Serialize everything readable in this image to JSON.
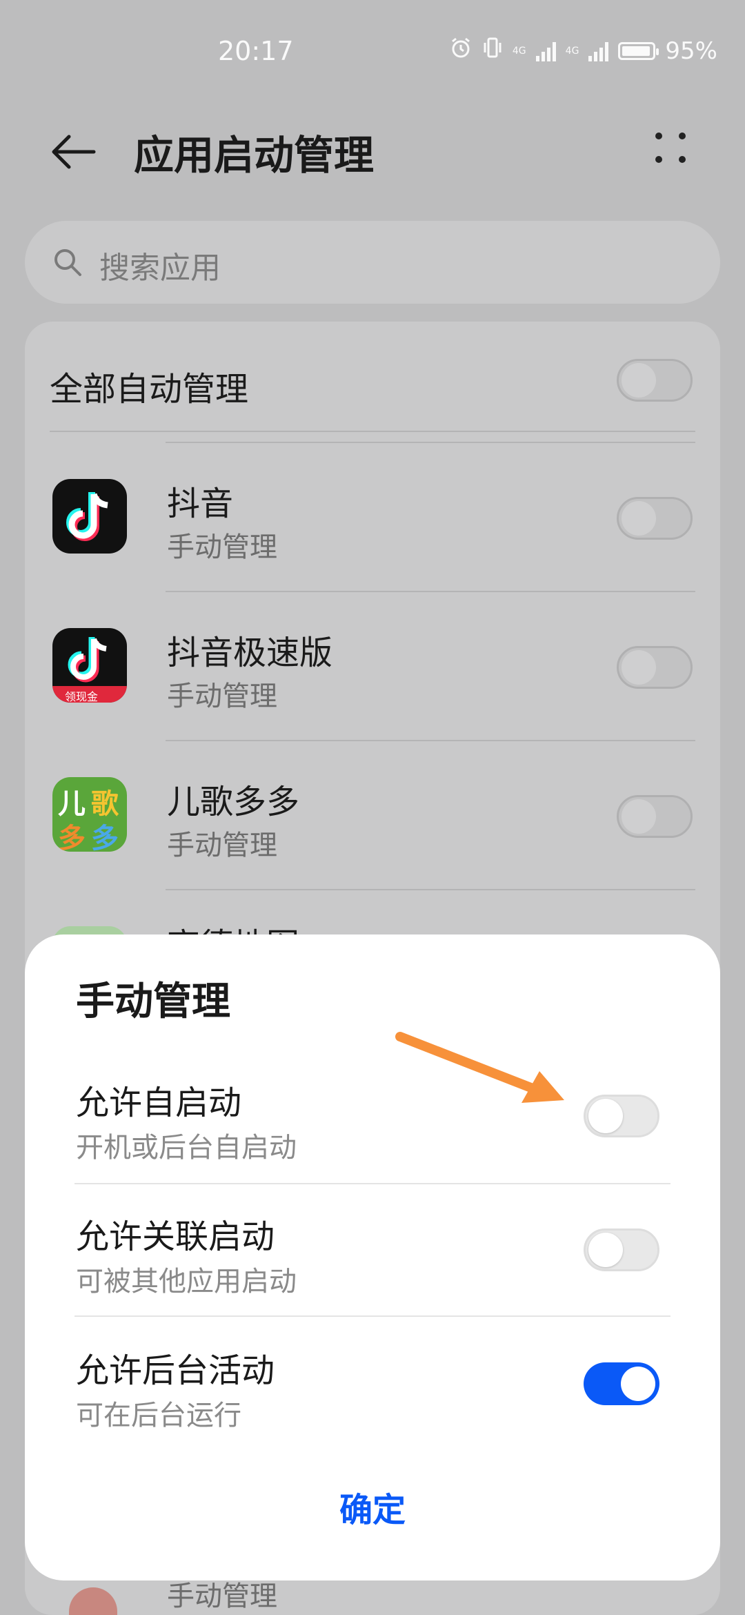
{
  "status_bar": {
    "time": "20:17",
    "battery": "95%",
    "battery_level": 0.95,
    "net1": "4G",
    "net2": "4G",
    "icons": [
      "alarm-icon",
      "vibrate-icon",
      "signal-icon",
      "signal-icon",
      "battery-icon"
    ]
  },
  "header": {
    "title": "应用启动管理",
    "back_icon": "arrow-left-icon",
    "more_icon": "more-dots-icon"
  },
  "search": {
    "placeholder": "搜索应用"
  },
  "list": {
    "all_label": "全部自动管理",
    "all_on": false,
    "apps": [
      {
        "name": "抖音",
        "mode": "手动管理",
        "on": false
      },
      {
        "name": "抖音极速版",
        "mode": "手动管理",
        "on": false,
        "badge": "领现金"
      },
      {
        "name": "儿歌多多",
        "mode": "手动管理",
        "on": false,
        "icon_text": [
          "儿",
          "歌",
          "多",
          "多"
        ]
      },
      {
        "name": "高德地图",
        "mode": "",
        "on": false
      },
      {
        "name": "",
        "mode": "手动管理",
        "on": false
      }
    ]
  },
  "sheet": {
    "title": "手动管理",
    "options": [
      {
        "title": "允许自启动",
        "sub": "开机或后台自启动",
        "on": false
      },
      {
        "title": "允许关联启动",
        "sub": "可被其他应用启动",
        "on": false
      },
      {
        "title": "允许后台活动",
        "sub": "可在后台运行",
        "on": true
      }
    ],
    "confirm": "确定"
  },
  "colors": {
    "accent": "#0a59f7",
    "annotation_arrow": "#f7913a",
    "backdrop": "#bdbdbe"
  }
}
